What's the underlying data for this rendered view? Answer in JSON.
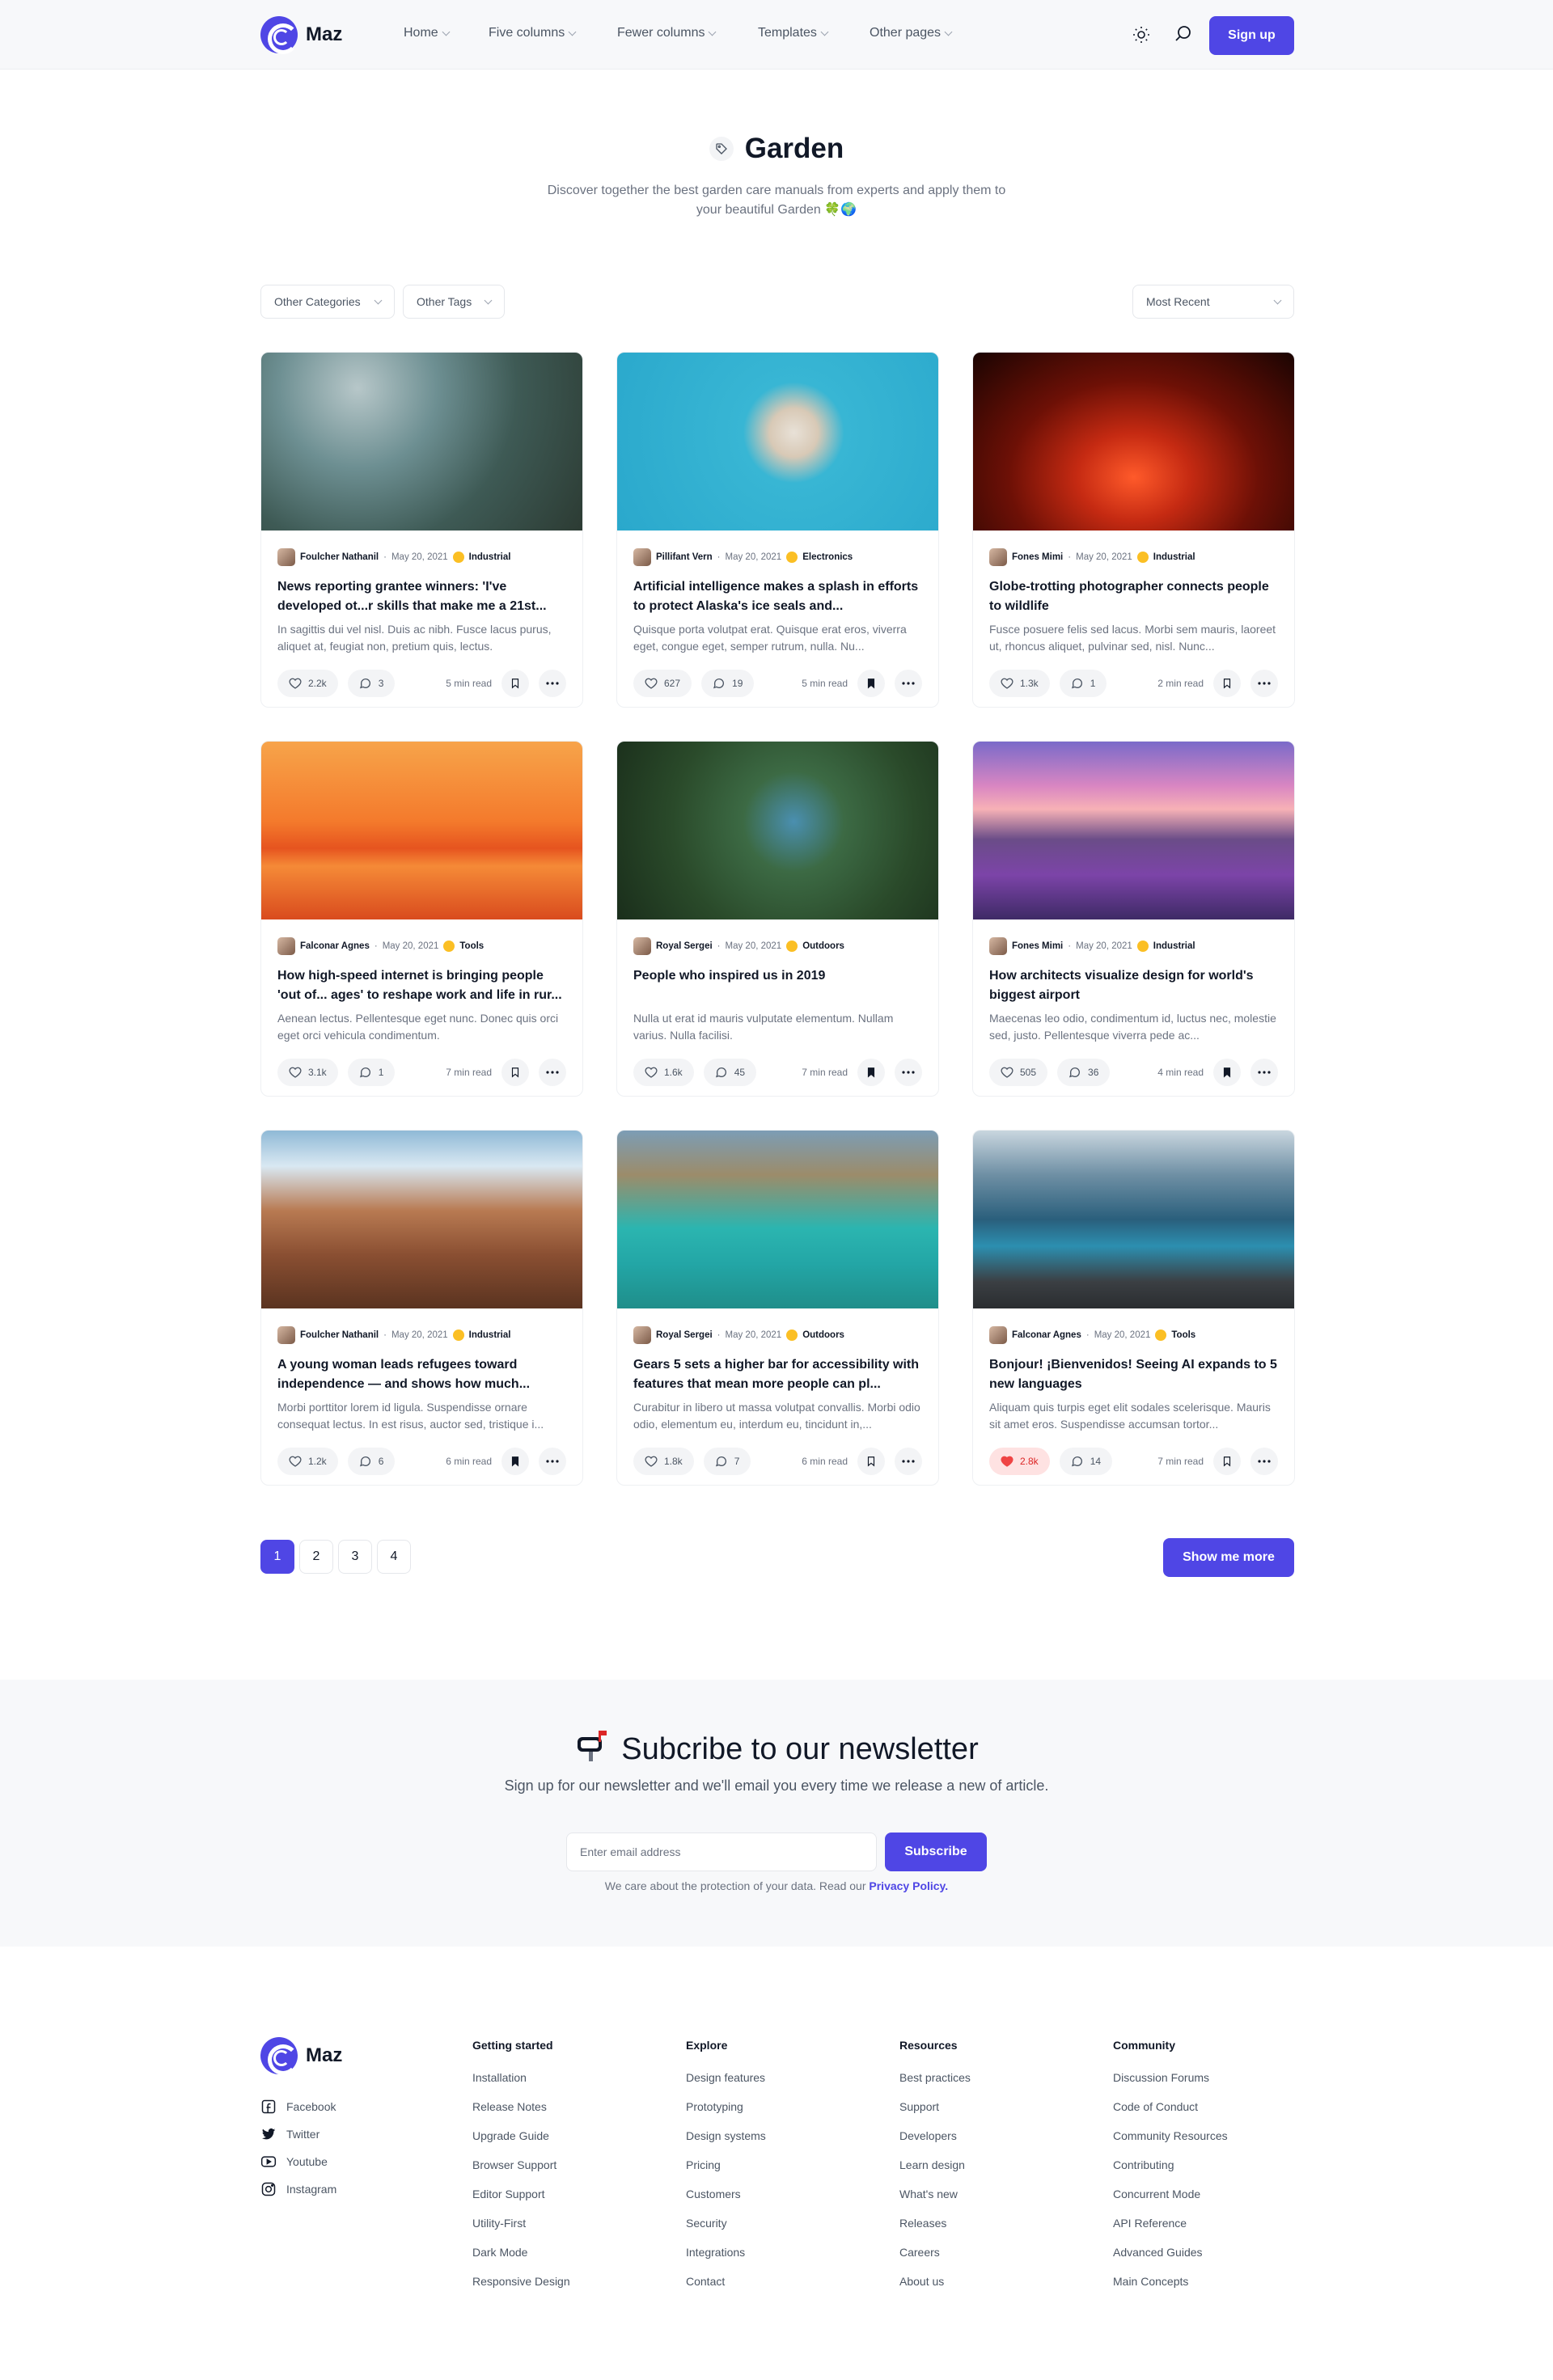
{
  "brand": {
    "name": "Maz",
    "accent": "#4f46e5"
  },
  "nav": {
    "items": [
      {
        "label": "Home"
      },
      {
        "label": "Five columns"
      },
      {
        "label": "Fewer columns"
      },
      {
        "label": "Templates"
      },
      {
        "label": "Other pages"
      }
    ],
    "signup_label": "Sign up"
  },
  "hero": {
    "title": "Garden",
    "description": "Discover together the best garden care manuals from experts and apply them to your beautiful Garden 🍀🌍"
  },
  "filters": {
    "categories": "Other Categories",
    "tags": "Other Tags",
    "sort": "Most Recent"
  },
  "posts": [
    {
      "author": "Foulcher Nathanil",
      "date": "May 20, 2021",
      "category": "Industrial",
      "title": "News reporting grantee winners: 'I've developed ot...r skills that make me a 21st...",
      "excerpt": "In sagittis dui vel nisl. Duis ac nibh. Fusce lacus purus, aliquet at, feugiat non, pretium quis, lectus.",
      "likes": "2.2k",
      "comments": "3",
      "read": "5 min read",
      "bookmarked": false,
      "liked": false
    },
    {
      "author": "Pillifant Vern",
      "date": "May 20, 2021",
      "category": "Electronics",
      "title": "Artificial intelligence makes a splash in efforts to protect Alaska's ice seals and...",
      "excerpt": "Quisque porta volutpat erat. Quisque erat eros, viverra eget, congue eget, semper rutrum, nulla. Nu...",
      "likes": "627",
      "comments": "19",
      "read": "5 min read",
      "bookmarked": true,
      "liked": false
    },
    {
      "author": "Fones Mimi",
      "date": "May 20, 2021",
      "category": "Industrial",
      "title": "Globe-trotting photographer connects people to wildlife",
      "excerpt": "Fusce posuere felis sed lacus. Morbi sem mauris, laoreet ut, rhoncus aliquet, pulvinar sed, nisl. Nunc...",
      "likes": "1.3k",
      "comments": "1",
      "read": "2 min read",
      "bookmarked": false,
      "liked": false
    },
    {
      "author": "Falconar Agnes",
      "date": "May 20, 2021",
      "category": "Tools",
      "title": "How high-speed internet is bringing people 'out of... ages' to reshape work and life in rur...",
      "excerpt": "Aenean lectus. Pellentesque eget nunc. Donec quis orci eget orci vehicula condimentum.",
      "likes": "3.1k",
      "comments": "1",
      "read": "7 min read",
      "bookmarked": false,
      "liked": false
    },
    {
      "author": "Royal Sergei",
      "date": "May 20, 2021",
      "category": "Outdoors",
      "title": "People who inspired us in 2019",
      "excerpt": "Nulla ut erat id mauris vulputate elementum. Nullam varius. Nulla facilisi.",
      "likes": "1.6k",
      "comments": "45",
      "read": "7 min read",
      "bookmarked": true,
      "liked": false
    },
    {
      "author": "Fones Mimi",
      "date": "May 20, 2021",
      "category": "Industrial",
      "title": "How architects visualize design for world's biggest airport",
      "excerpt": "Maecenas leo odio, condimentum id, luctus nec, molestie sed, justo. Pellentesque viverra pede ac...",
      "likes": "505",
      "comments": "36",
      "read": "4 min read",
      "bookmarked": true,
      "liked": false
    },
    {
      "author": "Foulcher Nathanil",
      "date": "May 20, 2021",
      "category": "Industrial",
      "title": "A young woman leads refugees toward independence — and shows how much...",
      "excerpt": "Morbi porttitor lorem id ligula. Suspendisse ornare consequat lectus. In est risus, auctor sed, tristique i...",
      "likes": "1.2k",
      "comments": "6",
      "read": "6 min read",
      "bookmarked": true,
      "liked": false
    },
    {
      "author": "Royal Sergei",
      "date": "May 20, 2021",
      "category": "Outdoors",
      "title": "Gears 5 sets a higher bar for accessibility with features that mean more people can pl...",
      "excerpt": "Curabitur in libero ut massa volutpat convallis. Morbi odio odio, elementum eu, interdum eu, tincidunt in,...",
      "likes": "1.8k",
      "comments": "7",
      "read": "6 min read",
      "bookmarked": false,
      "liked": false
    },
    {
      "author": "Falconar Agnes",
      "date": "May 20, 2021",
      "category": "Tools",
      "title": "Bonjour! ¡Bienvenidos! Seeing AI expands to 5 new languages",
      "excerpt": "Aliquam quis turpis eget elit sodales scelerisque. Mauris sit amet eros. Suspendisse accumsan tortor...",
      "likes": "2.8k",
      "comments": "14",
      "read": "7 min read",
      "bookmarked": false,
      "liked": true
    }
  ],
  "pagination": {
    "pages": [
      "1",
      "2",
      "3",
      "4"
    ],
    "active": "1",
    "more_label": "Show me more"
  },
  "newsletter": {
    "title": "Subcribe to our newsletter",
    "description": "Sign up for our newsletter and we'll email you every time we release a new of article.",
    "placeholder": "Enter email address",
    "button": "Subscribe",
    "note": "We care about the protection of your data. Read our",
    "policy_link": "Privacy Policy."
  },
  "footer": {
    "social": [
      {
        "label": "Facebook"
      },
      {
        "label": "Twitter"
      },
      {
        "label": "Youtube"
      },
      {
        "label": "Instagram"
      }
    ],
    "columns": [
      {
        "title": "Getting started",
        "links": [
          "Installation",
          "Release Notes",
          "Upgrade Guide",
          "Browser Support",
          "Editor Support",
          "Utility-First",
          "Dark Mode",
          "Responsive Design"
        ]
      },
      {
        "title": "Explore",
        "links": [
          "Design features",
          "Prototyping",
          "Design systems",
          "Pricing",
          "Customers",
          "Security",
          "Integrations",
          "Contact"
        ]
      },
      {
        "title": "Resources",
        "links": [
          "Best practices",
          "Support",
          "Developers",
          "Learn design",
          "What's new",
          "Releases",
          "Careers",
          "About us"
        ]
      },
      {
        "title": "Community",
        "links": [
          "Discussion Forums",
          "Code of Conduct",
          "Community Resources",
          "Contributing",
          "Concurrent Mode",
          "API Reference",
          "Advanced Guides",
          "Main Concepts"
        ]
      }
    ]
  }
}
